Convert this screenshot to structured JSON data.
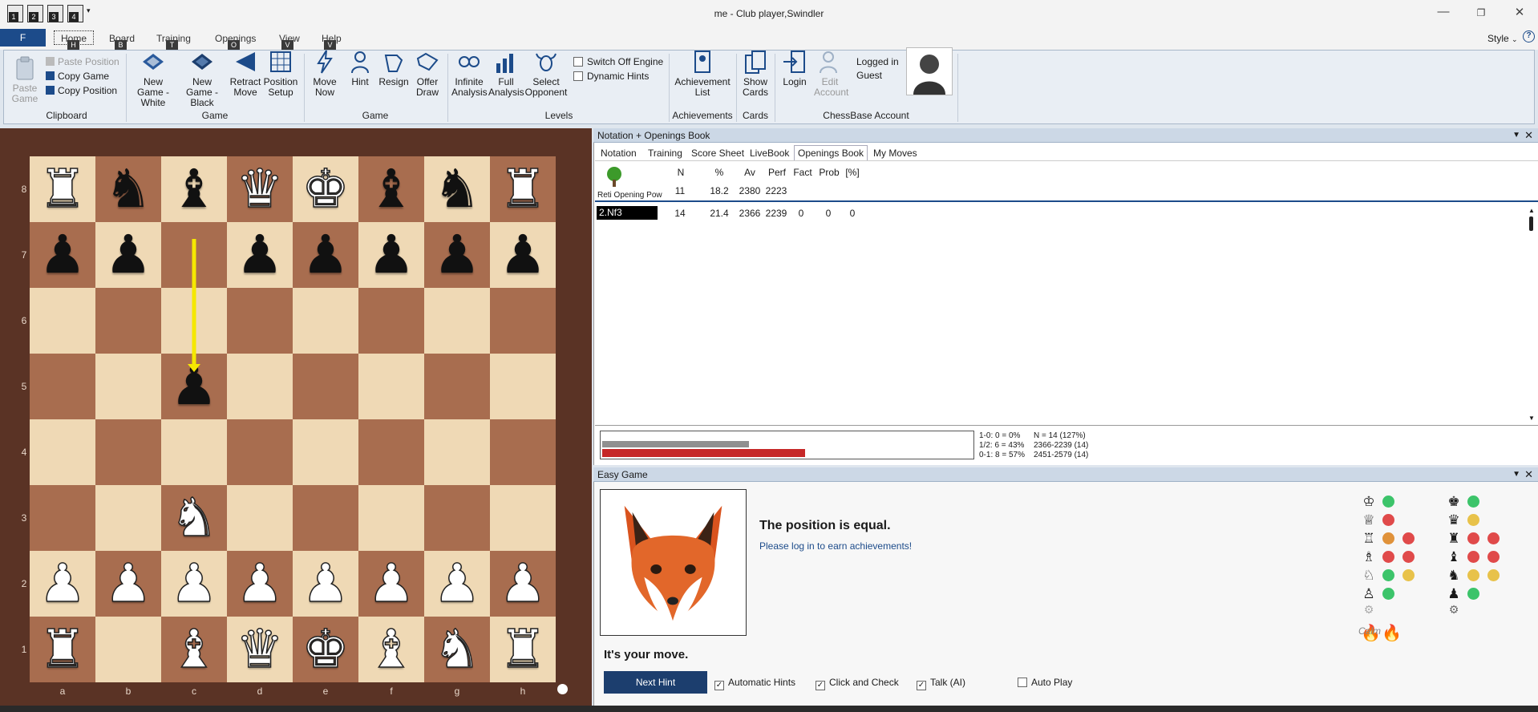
{
  "window": {
    "title": "me - Club player,Swindler",
    "qa_labels": [
      "1",
      "2",
      "3",
      "4"
    ]
  },
  "ribbon": {
    "file": "F",
    "tabs": [
      {
        "label": "Home",
        "key": "H"
      },
      {
        "label": "Board",
        "key": "B"
      },
      {
        "label": "Training",
        "key": "T"
      },
      {
        "label": "Openings",
        "key": "O"
      },
      {
        "label": "View",
        "key": "V"
      },
      {
        "label": "Help",
        "key": "V"
      }
    ],
    "style_label": "Style",
    "clipboard": {
      "paste_game": "Paste Game",
      "paste_position": "Paste Position",
      "copy_game": "Copy Game",
      "copy_position": "Copy Position",
      "group": "Clipboard"
    },
    "game": {
      "new_white": "New Game - White",
      "new_black": "New Game - Black",
      "retract": "Retract Move",
      "setup": "Position Setup",
      "group": "Game"
    },
    "game2": {
      "move_now": "Move Now",
      "hint": "Hint",
      "resign": "Resign",
      "offer_draw": "Offer Draw",
      "group": "Game"
    },
    "levels": {
      "infinite": "Infinite Analysis",
      "full": "Full Analysis",
      "select_opp": "Select Opponent",
      "switch_off": "Switch Off Engine",
      "dynamic_hints": "Dynamic Hints",
      "group": "Levels"
    },
    "achievements": {
      "list": "Achievement List",
      "group": "Achievements"
    },
    "cards": {
      "show": "Show Cards",
      "group": "Cards"
    },
    "account": {
      "login": "Login",
      "edit": "Edit Account",
      "logged": "Logged in",
      "guest": "Guest",
      "group": "ChessBase Account"
    }
  },
  "board": {
    "ranks": [
      "8",
      "7",
      "6",
      "5",
      "4",
      "3",
      "2",
      "1"
    ],
    "files": [
      "a",
      "b",
      "c",
      "d",
      "e",
      "f",
      "g",
      "h"
    ],
    "pieces": [
      {
        "sq": "a8",
        "p": "♜",
        "c": "w"
      },
      {
        "sq": "b8",
        "p": "♞",
        "c": "b"
      },
      {
        "sq": "c8",
        "p": "♝",
        "c": "b"
      },
      {
        "sq": "d8",
        "p": "♛",
        "c": "w"
      },
      {
        "sq": "e8",
        "p": "♚",
        "c": "w"
      },
      {
        "sq": "f8",
        "p": "♝",
        "c": "b"
      },
      {
        "sq": "g8",
        "p": "♞",
        "c": "b"
      },
      {
        "sq": "h8",
        "p": "♜",
        "c": "w"
      },
      {
        "sq": "a7",
        "p": "♟",
        "c": "b"
      },
      {
        "sq": "b7",
        "p": "♟",
        "c": "b"
      },
      {
        "sq": "d7",
        "p": "♟",
        "c": "b"
      },
      {
        "sq": "e7",
        "p": "♟",
        "c": "b"
      },
      {
        "sq": "f7",
        "p": "♟",
        "c": "b"
      },
      {
        "sq": "g7",
        "p": "♟",
        "c": "b"
      },
      {
        "sq": "h7",
        "p": "♟",
        "c": "b"
      },
      {
        "sq": "c5",
        "p": "♟",
        "c": "b"
      },
      {
        "sq": "c3",
        "p": "♞",
        "c": "w"
      },
      {
        "sq": "a2",
        "p": "♟",
        "c": "w"
      },
      {
        "sq": "b2",
        "p": "♟",
        "c": "w"
      },
      {
        "sq": "c2",
        "p": "♟",
        "c": "w"
      },
      {
        "sq": "d2",
        "p": "♟",
        "c": "w"
      },
      {
        "sq": "e2",
        "p": "♟",
        "c": "w"
      },
      {
        "sq": "f2",
        "p": "♟",
        "c": "w"
      },
      {
        "sq": "g2",
        "p": "♟",
        "c": "w"
      },
      {
        "sq": "h2",
        "p": "♟",
        "c": "w"
      },
      {
        "sq": "a1",
        "p": "♜",
        "c": "w"
      },
      {
        "sq": "c1",
        "p": "♝",
        "c": "w"
      },
      {
        "sq": "d1",
        "p": "♛",
        "c": "w"
      },
      {
        "sq": "e1",
        "p": "♚",
        "c": "w"
      },
      {
        "sq": "f1",
        "p": "♝",
        "c": "w"
      },
      {
        "sq": "g1",
        "p": "♞",
        "c": "w"
      },
      {
        "sq": "h1",
        "p": "♜",
        "c": "w"
      }
    ],
    "arrow": {
      "from": "c7",
      "to": "c5",
      "color": "#f5e800"
    },
    "light_color": "#efd9b5",
    "dark_color": "#a86d4f"
  },
  "notation_panel": {
    "title": "Notation + Openings Book",
    "tabs": [
      "Notation",
      "Training",
      "Score Sheet",
      "LiveBook",
      "Openings Book",
      "My Moves"
    ],
    "active_tab": "Openings Book",
    "headers": [
      "N",
      "%",
      "Av",
      "Perf",
      "Fact",
      "Prob",
      "[%]"
    ],
    "opening_name": "Reti Opening Pow",
    "summary": {
      "n": "11",
      "pct": "18.2",
      "av": "2380",
      "perf": "2223"
    },
    "rows": [
      {
        "move": "2.Nf3",
        "n": "14",
        "pct": "21.4",
        "av": "2366",
        "perf": "2239",
        "fact": "0",
        "prob": "0",
        "p": "0"
      }
    ],
    "stats": {
      "line1a": "1-0: 0 = 0%",
      "line1b": "N = 14 (127%)",
      "line2a": "1/2: 6 = 43%",
      "line2b": "2366-2239 (14)",
      "line3a": "0-1: 8 = 57%",
      "line3b": "2451-2579 (14)",
      "draw_pct": 43,
      "loss_pct": 57
    }
  },
  "easy_panel": {
    "title": "Easy Game",
    "status": "The position is equal.",
    "login_msg": "Please log in to earn achievements!",
    "your_move": "It's your move.",
    "next_hint": "Next Hint",
    "auto_hints": "Automatic Hints",
    "click_check": "Click and Check",
    "talk": "Talk (AI)",
    "auto_play": "Auto Play",
    "mood": "Calm"
  }
}
